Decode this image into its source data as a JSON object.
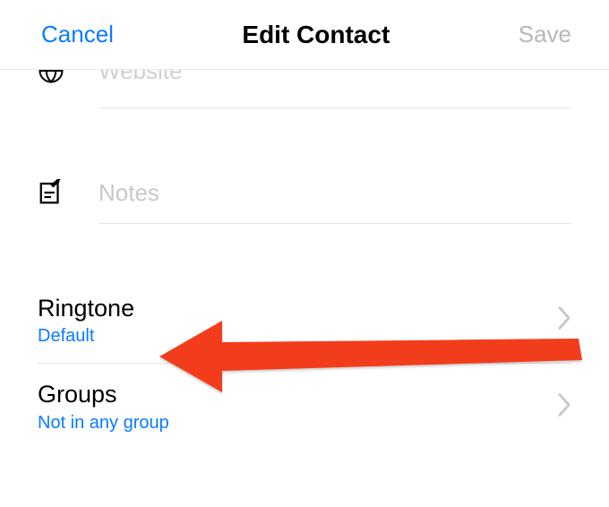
{
  "header": {
    "cancel": "Cancel",
    "title": "Edit Contact",
    "save": "Save"
  },
  "fields": {
    "website": {
      "placeholder": "Website",
      "value": ""
    },
    "notes": {
      "placeholder": "Notes",
      "value": ""
    }
  },
  "settings": {
    "ringtone": {
      "title": "Ringtone",
      "value": "Default"
    },
    "groups": {
      "title": "Groups",
      "value": "Not in any group"
    }
  },
  "icons": {
    "globe": "globe-icon",
    "notes": "notes-icon",
    "chevron": "chevron-right-icon"
  },
  "annotation": {
    "arrow_target": "ringtone"
  }
}
